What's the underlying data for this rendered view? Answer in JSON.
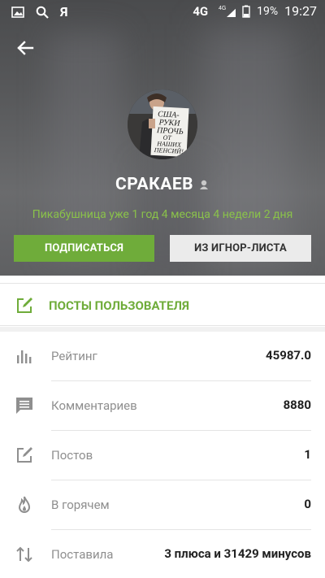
{
  "statusbar": {
    "ya": "Я",
    "network": "4G",
    "network_sup": "4G",
    "battery": "19%",
    "time": "19:27"
  },
  "profile": {
    "username": "СРАКАЕВ",
    "tenure": "Пикабушница уже 1 год 4 месяца 4 недели 2 дня",
    "subscribe_label": "ПОДПИСАТЬСЯ",
    "ignore_label": "ИЗ ИГНОР-ЛИСТА",
    "avatar_sign": [
      "США-",
      "РУКИ",
      "ПРОЧЬ",
      "ОТ",
      "НАШИХ",
      "ПЕНСИЙ!"
    ]
  },
  "posts_link": {
    "label": "ПОСТЫ ПОЛЬЗОВАТЕЛЯ"
  },
  "stats": [
    {
      "icon": "bar-chart-icon",
      "label": "Рейтинг",
      "value": "45987.0"
    },
    {
      "icon": "comments-icon",
      "label": "Комментариев",
      "value": "8880"
    },
    {
      "icon": "edit-icon",
      "label": "Постов",
      "value": "1"
    },
    {
      "icon": "flame-icon",
      "label": "В горячем",
      "value": "0"
    },
    {
      "icon": "up-down-arrows-icon",
      "label": "Поставила",
      "value": "3 плюса и 31429 минусов"
    }
  ],
  "colors": {
    "accent_green": "#6fac3a",
    "tenure_green": "#8ac24a",
    "header_gray": "#58595b"
  }
}
